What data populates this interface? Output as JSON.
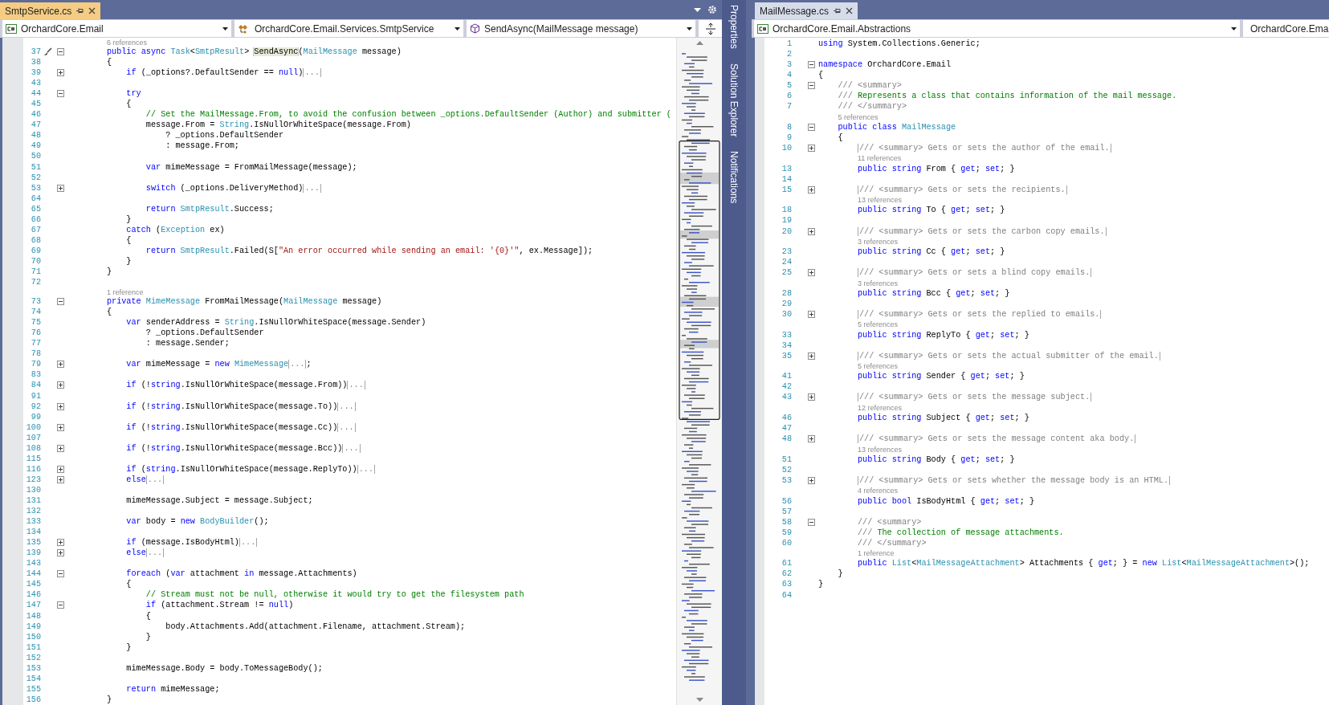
{
  "left_pane": {
    "tab": {
      "title": "SmtpService.cs",
      "selected": true
    },
    "nav": [
      {
        "label": "OrchardCore.Email",
        "kind": "project"
      },
      {
        "label": "OrchardCore.Email.Services.SmtpService",
        "kind": "class"
      },
      {
        "label": "SendAsync(MailMessage message)",
        "kind": "method"
      }
    ],
    "lines": [
      {
        "kind": "codelens",
        "text": "        6 references"
      },
      {
        "kind": "code",
        "n": "37",
        "expanded": true,
        "quick_action": true,
        "code": [
          {
            "kind": "keyword",
            "text": "        public async "
          },
          {
            "kind": "type",
            "text": "Task"
          },
          {
            "kind": "plain",
            "text": "<"
          },
          {
            "kind": "type",
            "text": "SmtpResult"
          },
          {
            "kind": "plain",
            "text": "> "
          },
          {
            "kind": "highlight",
            "text": "SendAsync"
          },
          {
            "kind": "plain",
            "text": "("
          },
          {
            "kind": "type",
            "text": "MailMessage"
          },
          {
            "kind": "plain",
            "text": " message)"
          }
        ]
      },
      {
        "kind": "code",
        "n": "38",
        "code": [
          {
            "kind": "plain",
            "text": "        {"
          }
        ]
      },
      {
        "kind": "code",
        "n": "39",
        "expanded": false,
        "code": [
          {
            "kind": "keyword",
            "text": "            if"
          },
          {
            "kind": "plain",
            "text": " (_options?.DefaultSender == "
          },
          {
            "kind": "keyword",
            "text": "null"
          },
          {
            "kind": "plain",
            "text": ")"
          },
          {
            "kind": "fold",
            "text": "..."
          }
        ]
      },
      {
        "kind": "code",
        "n": "43"
      },
      {
        "kind": "code",
        "n": "44",
        "expanded": true,
        "code": [
          {
            "kind": "keyword",
            "text": "            try"
          }
        ]
      },
      {
        "kind": "code",
        "n": "45",
        "code": [
          {
            "kind": "plain",
            "text": "            {"
          }
        ]
      },
      {
        "kind": "code",
        "n": "46",
        "code": [
          {
            "kind": "comment",
            "text": "                // Set the MailMessage.From, to avoid the confusion between _options.DefaultSender (Author) and submitter ("
          }
        ]
      },
      {
        "kind": "code",
        "n": "47",
        "code": [
          {
            "kind": "plain",
            "text": "                message.From = "
          },
          {
            "kind": "type",
            "text": "String"
          },
          {
            "kind": "plain",
            "text": ".IsNullOrWhiteSpace(message.From)"
          }
        ]
      },
      {
        "kind": "code",
        "n": "48",
        "code": [
          {
            "kind": "plain",
            "text": "                    ? _options.DefaultSender"
          }
        ]
      },
      {
        "kind": "code",
        "n": "49",
        "code": [
          {
            "kind": "plain",
            "text": "                    : message.From;"
          }
        ]
      },
      {
        "kind": "code",
        "n": "50"
      },
      {
        "kind": "code",
        "n": "51",
        "code": [
          {
            "kind": "keyword",
            "text": "                var"
          },
          {
            "kind": "plain",
            "text": " mimeMessage = FromMailMessage(message);"
          }
        ]
      },
      {
        "kind": "code",
        "n": "52"
      },
      {
        "kind": "code",
        "n": "53",
        "expanded": false,
        "code": [
          {
            "kind": "keyword",
            "text": "                switch"
          },
          {
            "kind": "plain",
            "text": " (_options.DeliveryMethod)"
          },
          {
            "kind": "fold",
            "text": "..."
          }
        ]
      },
      {
        "kind": "code",
        "n": "64"
      },
      {
        "kind": "code",
        "n": "65",
        "code": [
          {
            "kind": "keyword",
            "text": "                return "
          },
          {
            "kind": "type",
            "text": "SmtpResult"
          },
          {
            "kind": "plain",
            "text": ".Success;"
          }
        ]
      },
      {
        "kind": "code",
        "n": "66",
        "code": [
          {
            "kind": "plain",
            "text": "            }"
          }
        ]
      },
      {
        "kind": "code",
        "n": "67",
        "code": [
          {
            "kind": "keyword",
            "text": "            catch"
          },
          {
            "kind": "plain",
            "text": " ("
          },
          {
            "kind": "type",
            "text": "Exception"
          },
          {
            "kind": "plain",
            "text": " ex)"
          }
        ]
      },
      {
        "kind": "code",
        "n": "68",
        "code": [
          {
            "kind": "plain",
            "text": "            {"
          }
        ]
      },
      {
        "kind": "code",
        "n": "69",
        "code": [
          {
            "kind": "keyword",
            "text": "                return "
          },
          {
            "kind": "type",
            "text": "SmtpResult"
          },
          {
            "kind": "plain",
            "text": ".Failed(S["
          },
          {
            "kind": "string",
            "text": "\"An error occurred while sending an email: '{0}'\""
          },
          {
            "kind": "plain",
            "text": ", ex.Message]);"
          }
        ]
      },
      {
        "kind": "code",
        "n": "70",
        "code": [
          {
            "kind": "plain",
            "text": "            }"
          }
        ]
      },
      {
        "kind": "code",
        "n": "71",
        "code": [
          {
            "kind": "plain",
            "text": "        }"
          }
        ]
      },
      {
        "kind": "code",
        "n": "72"
      },
      {
        "kind": "codelens",
        "text": "        1 reference"
      },
      {
        "kind": "code",
        "n": "73",
        "expanded": true,
        "code": [
          {
            "kind": "keyword",
            "text": "        private "
          },
          {
            "kind": "type",
            "text": "MimeMessage"
          },
          {
            "kind": "plain",
            "text": " FromMailMessage("
          },
          {
            "kind": "type",
            "text": "MailMessage"
          },
          {
            "kind": "plain",
            "text": " message)"
          }
        ]
      },
      {
        "kind": "code",
        "n": "74",
        "code": [
          {
            "kind": "plain",
            "text": "        {"
          }
        ]
      },
      {
        "kind": "code",
        "n": "75",
        "code": [
          {
            "kind": "keyword",
            "text": "            var"
          },
          {
            "kind": "plain",
            "text": " senderAddress = "
          },
          {
            "kind": "type",
            "text": "String"
          },
          {
            "kind": "plain",
            "text": ".IsNullOrWhiteSpace(message.Sender)"
          }
        ]
      },
      {
        "kind": "code",
        "n": "76",
        "code": [
          {
            "kind": "plain",
            "text": "                ? _options.DefaultSender"
          }
        ]
      },
      {
        "kind": "code",
        "n": "77",
        "code": [
          {
            "kind": "plain",
            "text": "                : message.Sender;"
          }
        ]
      },
      {
        "kind": "code",
        "n": "78"
      },
      {
        "kind": "code",
        "n": "79",
        "expanded": false,
        "code": [
          {
            "kind": "keyword",
            "text": "            var"
          },
          {
            "kind": "plain",
            "text": " mimeMessage = "
          },
          {
            "kind": "keyword",
            "text": "new "
          },
          {
            "kind": "type",
            "text": "MimeMessage"
          },
          {
            "kind": "fold",
            "text": "..."
          },
          {
            "kind": "plain",
            "text": ";"
          }
        ]
      },
      {
        "kind": "code",
        "n": "83"
      },
      {
        "kind": "code",
        "n": "84",
        "expanded": false,
        "code": [
          {
            "kind": "keyword",
            "text": "            if"
          },
          {
            "kind": "plain",
            "text": " (!"
          },
          {
            "kind": "keyword",
            "text": "string"
          },
          {
            "kind": "plain",
            "text": ".IsNullOrWhiteSpace(message.From))"
          },
          {
            "kind": "fold",
            "text": "..."
          }
        ]
      },
      {
        "kind": "code",
        "n": "91"
      },
      {
        "kind": "code",
        "n": "92",
        "expanded": false,
        "code": [
          {
            "kind": "keyword",
            "text": "            if"
          },
          {
            "kind": "plain",
            "text": " (!"
          },
          {
            "kind": "keyword",
            "text": "string"
          },
          {
            "kind": "plain",
            "text": ".IsNullOrWhiteSpace(message.To))"
          },
          {
            "kind": "fold",
            "text": "..."
          }
        ]
      },
      {
        "kind": "code",
        "n": "99"
      },
      {
        "kind": "code",
        "n": "100",
        "expanded": false,
        "code": [
          {
            "kind": "keyword",
            "text": "            if"
          },
          {
            "kind": "plain",
            "text": " (!"
          },
          {
            "kind": "keyword",
            "text": "string"
          },
          {
            "kind": "plain",
            "text": ".IsNullOrWhiteSpace(message.Cc))"
          },
          {
            "kind": "fold",
            "text": "..."
          }
        ]
      },
      {
        "kind": "code",
        "n": "107"
      },
      {
        "kind": "code",
        "n": "108",
        "expanded": false,
        "code": [
          {
            "kind": "keyword",
            "text": "            if"
          },
          {
            "kind": "plain",
            "text": " (!"
          },
          {
            "kind": "keyword",
            "text": "string"
          },
          {
            "kind": "plain",
            "text": ".IsNullOrWhiteSpace(message.Bcc))"
          },
          {
            "kind": "fold",
            "text": "..."
          }
        ]
      },
      {
        "kind": "code",
        "n": "115"
      },
      {
        "kind": "code",
        "n": "116",
        "expanded": false,
        "code": [
          {
            "kind": "keyword",
            "text": "            if"
          },
          {
            "kind": "plain",
            "text": " ("
          },
          {
            "kind": "keyword",
            "text": "string"
          },
          {
            "kind": "plain",
            "text": ".IsNullOrWhiteSpace(message.ReplyTo))"
          },
          {
            "kind": "fold",
            "text": "..."
          }
        ]
      },
      {
        "kind": "code",
        "n": "123",
        "expanded": false,
        "code": [
          {
            "kind": "keyword",
            "text": "            else"
          },
          {
            "kind": "fold",
            "text": "..."
          }
        ]
      },
      {
        "kind": "code",
        "n": "130"
      },
      {
        "kind": "code",
        "n": "131",
        "code": [
          {
            "kind": "plain",
            "text": "            mimeMessage.Subject = message.Subject;"
          }
        ]
      },
      {
        "kind": "code",
        "n": "132"
      },
      {
        "kind": "code",
        "n": "133",
        "code": [
          {
            "kind": "keyword",
            "text": "            var"
          },
          {
            "kind": "plain",
            "text": " body = "
          },
          {
            "kind": "keyword",
            "text": "new "
          },
          {
            "kind": "type",
            "text": "BodyBuilder"
          },
          {
            "kind": "plain",
            "text": "();"
          }
        ]
      },
      {
        "kind": "code",
        "n": "134"
      },
      {
        "kind": "code",
        "n": "135",
        "expanded": false,
        "code": [
          {
            "kind": "keyword",
            "text": "            if"
          },
          {
            "kind": "plain",
            "text": " (message.IsBodyHtml)"
          },
          {
            "kind": "fold",
            "text": "..."
          }
        ]
      },
      {
        "kind": "code",
        "n": "139",
        "expanded": false,
        "code": [
          {
            "kind": "keyword",
            "text": "            else"
          },
          {
            "kind": "fold",
            "text": "..."
          }
        ]
      },
      {
        "kind": "code",
        "n": "143"
      },
      {
        "kind": "code",
        "n": "144",
        "expanded": true,
        "code": [
          {
            "kind": "keyword",
            "text": "            foreach"
          },
          {
            "kind": "plain",
            "text": " ("
          },
          {
            "kind": "keyword",
            "text": "var"
          },
          {
            "kind": "plain",
            "text": " attachment "
          },
          {
            "kind": "keyword",
            "text": "in"
          },
          {
            "kind": "plain",
            "text": " message.Attachments)"
          }
        ]
      },
      {
        "kind": "code",
        "n": "145",
        "code": [
          {
            "kind": "plain",
            "text": "            {"
          }
        ]
      },
      {
        "kind": "code",
        "n": "146",
        "code": [
          {
            "kind": "comment",
            "text": "                // Stream must not be null, otherwise it would try to get the filesystem path"
          }
        ]
      },
      {
        "kind": "code",
        "n": "147",
        "expanded": true,
        "code": [
          {
            "kind": "keyword",
            "text": "                if"
          },
          {
            "kind": "plain",
            "text": " (attachment.Stream != "
          },
          {
            "kind": "keyword",
            "text": "null"
          },
          {
            "kind": "plain",
            "text": ")"
          }
        ]
      },
      {
        "kind": "code",
        "n": "148",
        "code": [
          {
            "kind": "plain",
            "text": "                {"
          }
        ]
      },
      {
        "kind": "code",
        "n": "149",
        "code": [
          {
            "kind": "plain",
            "text": "                    body.Attachments.Add(attachment.Filename, attachment.Stream);"
          }
        ]
      },
      {
        "kind": "code",
        "n": "150",
        "code": [
          {
            "kind": "plain",
            "text": "                }"
          }
        ]
      },
      {
        "kind": "code",
        "n": "151",
        "code": [
          {
            "kind": "plain",
            "text": "            }"
          }
        ]
      },
      {
        "kind": "code",
        "n": "152"
      },
      {
        "kind": "code",
        "n": "153",
        "code": [
          {
            "kind": "plain",
            "text": "            mimeMessage.Body = body.ToMessageBody();"
          }
        ]
      },
      {
        "kind": "code",
        "n": "154"
      },
      {
        "kind": "code",
        "n": "155",
        "code": [
          {
            "kind": "keyword",
            "text": "            return"
          },
          {
            "kind": "plain",
            "text": " mimeMessage;"
          }
        ]
      },
      {
        "kind": "code",
        "n": "156",
        "code": [
          {
            "kind": "plain",
            "text": "        }"
          }
        ]
      }
    ]
  },
  "tool_strip": [
    "Properties",
    "Solution Explorer",
    "Notifications"
  ],
  "right_pane": {
    "tab": {
      "title": "MailMessage.cs",
      "selected": false
    },
    "nav": [
      {
        "label": "OrchardCore.Email.Abstractions",
        "kind": "project"
      },
      {
        "label": "OrchardCore.Ema",
        "kind": "class"
      }
    ],
    "lines": [
      {
        "kind": "code",
        "n": "1",
        "code": [
          {
            "kind": "keyword",
            "text": "using"
          },
          {
            "kind": "plain",
            "text": " System.Collections.Generic;"
          }
        ]
      },
      {
        "kind": "code",
        "n": "2"
      },
      {
        "kind": "code",
        "n": "3",
        "expanded": true,
        "code": [
          {
            "kind": "keyword",
            "text": "namespace"
          },
          {
            "kind": "plain",
            "text": " OrchardCore.Email"
          }
        ]
      },
      {
        "kind": "code",
        "n": "4",
        "code": [
          {
            "kind": "plain",
            "text": "{"
          }
        ]
      },
      {
        "kind": "code",
        "n": "5",
        "expanded": true,
        "code": [
          {
            "kind": "doc",
            "text": "    /// <summary>"
          }
        ]
      },
      {
        "kind": "code",
        "n": "6",
        "code": [
          {
            "kind": "doc",
            "text": "    /// "
          },
          {
            "kind": "comment",
            "text": "Represents a class that contains information of the mail message."
          }
        ]
      },
      {
        "kind": "code",
        "n": "7",
        "code": [
          {
            "kind": "doc",
            "text": "    /// </summary>"
          }
        ]
      },
      {
        "kind": "codelens",
        "text": "    5 references"
      },
      {
        "kind": "code",
        "n": "8",
        "expanded": true,
        "code": [
          {
            "kind": "keyword",
            "text": "    public class "
          },
          {
            "kind": "type",
            "text": "MailMessage"
          }
        ]
      },
      {
        "kind": "code",
        "n": "9",
        "code": [
          {
            "kind": "plain",
            "text": "    {"
          }
        ]
      },
      {
        "kind": "code",
        "n": "10",
        "expanded": false,
        "code": [
          {
            "kind": "box",
            "text": "        /// <summary> Gets or sets the author of the email."
          }
        ]
      },
      {
        "kind": "codelens",
        "text": "        11 references"
      },
      {
        "kind": "code",
        "n": "13",
        "code": [
          {
            "kind": "keyword",
            "text": "        public string "
          },
          {
            "kind": "plain",
            "text": "From { "
          },
          {
            "kind": "keyword",
            "text": "get"
          },
          {
            "kind": "plain",
            "text": "; "
          },
          {
            "kind": "keyword",
            "text": "set"
          },
          {
            "kind": "plain",
            "text": "; }"
          }
        ]
      },
      {
        "kind": "code",
        "n": "14"
      },
      {
        "kind": "code",
        "n": "15",
        "expanded": false,
        "code": [
          {
            "kind": "box",
            "text": "        /// <summary> Gets or sets the recipients."
          }
        ]
      },
      {
        "kind": "codelens",
        "text": "        13 references"
      },
      {
        "kind": "code",
        "n": "18",
        "code": [
          {
            "kind": "keyword",
            "text": "        public string "
          },
          {
            "kind": "plain",
            "text": "To { "
          },
          {
            "kind": "keyword",
            "text": "get"
          },
          {
            "kind": "plain",
            "text": "; "
          },
          {
            "kind": "keyword",
            "text": "set"
          },
          {
            "kind": "plain",
            "text": "; }"
          }
        ]
      },
      {
        "kind": "code",
        "n": "19"
      },
      {
        "kind": "code",
        "n": "20",
        "expanded": false,
        "code": [
          {
            "kind": "box",
            "text": "        /// <summary> Gets or sets the carbon copy emails."
          }
        ]
      },
      {
        "kind": "codelens",
        "text": "        3 references"
      },
      {
        "kind": "code",
        "n": "23",
        "code": [
          {
            "kind": "keyword",
            "text": "        public string "
          },
          {
            "kind": "plain",
            "text": "Cc { "
          },
          {
            "kind": "keyword",
            "text": "get"
          },
          {
            "kind": "plain",
            "text": "; "
          },
          {
            "kind": "keyword",
            "text": "set"
          },
          {
            "kind": "plain",
            "text": "; }"
          }
        ]
      },
      {
        "kind": "code",
        "n": "24"
      },
      {
        "kind": "code",
        "n": "25",
        "expanded": false,
        "code": [
          {
            "kind": "box",
            "text": "        /// <summary> Gets or sets a blind copy emails."
          }
        ]
      },
      {
        "kind": "codelens",
        "text": "        3 references"
      },
      {
        "kind": "code",
        "n": "28",
        "code": [
          {
            "kind": "keyword",
            "text": "        public string "
          },
          {
            "kind": "plain",
            "text": "Bcc { "
          },
          {
            "kind": "keyword",
            "text": "get"
          },
          {
            "kind": "plain",
            "text": "; "
          },
          {
            "kind": "keyword",
            "text": "set"
          },
          {
            "kind": "plain",
            "text": "; }"
          }
        ]
      },
      {
        "kind": "code",
        "n": "29"
      },
      {
        "kind": "code",
        "n": "30",
        "expanded": false,
        "code": [
          {
            "kind": "box",
            "text": "        /// <summary> Gets or sets the replied to emails."
          }
        ]
      },
      {
        "kind": "codelens",
        "text": "        5 references"
      },
      {
        "kind": "code",
        "n": "33",
        "code": [
          {
            "kind": "keyword",
            "text": "        public string "
          },
          {
            "kind": "plain",
            "text": "ReplyTo { "
          },
          {
            "kind": "keyword",
            "text": "get"
          },
          {
            "kind": "plain",
            "text": "; "
          },
          {
            "kind": "keyword",
            "text": "set"
          },
          {
            "kind": "plain",
            "text": "; }"
          }
        ]
      },
      {
        "kind": "code",
        "n": "34"
      },
      {
        "kind": "code",
        "n": "35",
        "expanded": false,
        "code": [
          {
            "kind": "box",
            "text": "        /// <summary> Gets or sets the actual submitter of the email."
          }
        ]
      },
      {
        "kind": "codelens",
        "text": "        5 references"
      },
      {
        "kind": "code",
        "n": "41",
        "code": [
          {
            "kind": "keyword",
            "text": "        public string "
          },
          {
            "kind": "plain",
            "text": "Sender { "
          },
          {
            "kind": "keyword",
            "text": "get"
          },
          {
            "kind": "plain",
            "text": "; "
          },
          {
            "kind": "keyword",
            "text": "set"
          },
          {
            "kind": "plain",
            "text": "; }"
          }
        ]
      },
      {
        "kind": "code",
        "n": "42"
      },
      {
        "kind": "code",
        "n": "43",
        "expanded": false,
        "code": [
          {
            "kind": "box",
            "text": "        /// <summary> Gets or sets the message subject."
          }
        ]
      },
      {
        "kind": "codelens",
        "text": "        12 references"
      },
      {
        "kind": "code",
        "n": "46",
        "code": [
          {
            "kind": "keyword",
            "text": "        public string "
          },
          {
            "kind": "plain",
            "text": "Subject { "
          },
          {
            "kind": "keyword",
            "text": "get"
          },
          {
            "kind": "plain",
            "text": "; "
          },
          {
            "kind": "keyword",
            "text": "set"
          },
          {
            "kind": "plain",
            "text": "; }"
          }
        ]
      },
      {
        "kind": "code",
        "n": "47"
      },
      {
        "kind": "code",
        "n": "48",
        "expanded": false,
        "code": [
          {
            "kind": "box",
            "text": "        /// <summary> Gets or sets the message content aka body."
          }
        ]
      },
      {
        "kind": "codelens",
        "text": "        13 references"
      },
      {
        "kind": "code",
        "n": "51",
        "code": [
          {
            "kind": "keyword",
            "text": "        public string "
          },
          {
            "kind": "plain",
            "text": "Body { "
          },
          {
            "kind": "keyword",
            "text": "get"
          },
          {
            "kind": "plain",
            "text": "; "
          },
          {
            "kind": "keyword",
            "text": "set"
          },
          {
            "kind": "plain",
            "text": "; }"
          }
        ]
      },
      {
        "kind": "code",
        "n": "52"
      },
      {
        "kind": "code",
        "n": "53",
        "expanded": false,
        "code": [
          {
            "kind": "box",
            "text": "        /// <summary> Gets or sets whether the message body is an HTML."
          }
        ]
      },
      {
        "kind": "codelens",
        "text": "        4 references"
      },
      {
        "kind": "code",
        "n": "56",
        "code": [
          {
            "kind": "keyword",
            "text": "        public bool "
          },
          {
            "kind": "plain",
            "text": "IsBodyHtml { "
          },
          {
            "kind": "keyword",
            "text": "get"
          },
          {
            "kind": "plain",
            "text": "; "
          },
          {
            "kind": "keyword",
            "text": "set"
          },
          {
            "kind": "plain",
            "text": "; }"
          }
        ]
      },
      {
        "kind": "code",
        "n": "57"
      },
      {
        "kind": "code",
        "n": "58",
        "expanded": true,
        "code": [
          {
            "kind": "doc",
            "text": "        /// <summary>"
          }
        ]
      },
      {
        "kind": "code",
        "n": "59",
        "code": [
          {
            "kind": "doc",
            "text": "        /// "
          },
          {
            "kind": "comment",
            "text": "The collection of message attachments."
          }
        ]
      },
      {
        "kind": "code",
        "n": "60",
        "code": [
          {
            "kind": "doc",
            "text": "        /// </summary>"
          }
        ]
      },
      {
        "kind": "codelens",
        "text": "        1 reference"
      },
      {
        "kind": "code",
        "n": "61",
        "code": [
          {
            "kind": "keyword",
            "text": "        public "
          },
          {
            "kind": "type",
            "text": "List"
          },
          {
            "kind": "plain",
            "text": "<"
          },
          {
            "kind": "type",
            "text": "MailMessageAttachment"
          },
          {
            "kind": "plain",
            "text": "> Attachments { "
          },
          {
            "kind": "keyword",
            "text": "get"
          },
          {
            "kind": "plain",
            "text": "; } = "
          },
          {
            "kind": "keyword",
            "text": "new "
          },
          {
            "kind": "type",
            "text": "List"
          },
          {
            "kind": "plain",
            "text": "<"
          },
          {
            "kind": "type",
            "text": "MailMessageAttachment"
          },
          {
            "kind": "plain",
            "text": ">();"
          }
        ]
      },
      {
        "kind": "code",
        "n": "62",
        "code": [
          {
            "kind": "plain",
            "text": "    }"
          }
        ]
      },
      {
        "kind": "code",
        "n": "63",
        "code": [
          {
            "kind": "plain",
            "text": "}"
          }
        ]
      },
      {
        "kind": "code",
        "n": "64"
      }
    ]
  }
}
